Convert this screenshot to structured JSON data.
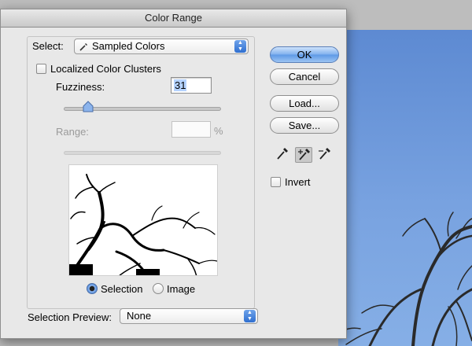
{
  "dialog": {
    "title": "Color Range",
    "select_label": "Select:",
    "select_value": "Sampled Colors",
    "localized_label": "Localized Color Clusters",
    "localized_checked": false,
    "fuzziness_label": "Fuzziness:",
    "fuzziness_value": "31",
    "range_label": "Range:",
    "range_value": "",
    "range_unit": "%",
    "radio_selection": "Selection",
    "radio_image": "Image",
    "radio_checked": "Selection",
    "preview_label": "Selection Preview:",
    "preview_value": "None",
    "buttons": {
      "ok": "OK",
      "cancel": "Cancel",
      "load": "Load...",
      "save": "Save..."
    },
    "invert_label": "Invert",
    "invert_checked": false,
    "active_tool": "eyedropper-plus"
  },
  "colors": {
    "accent": "#5d98e6",
    "photo_sky": "#78a2e0"
  }
}
